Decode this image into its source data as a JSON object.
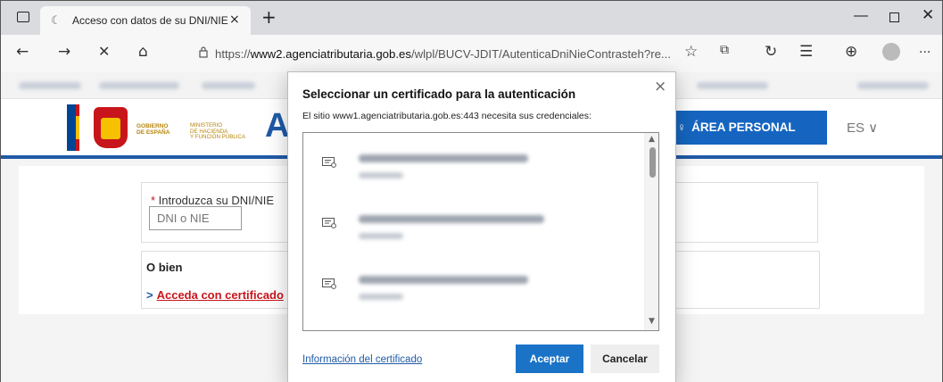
{
  "browser": {
    "tab": {
      "title": "Acceso con datos de su DNI/NIE",
      "close": "×",
      "favicon": "☾"
    },
    "new_tab": "+",
    "window": {
      "minimize": "—",
      "close": "✕"
    },
    "nav": {
      "back": "←",
      "forward": "→",
      "stop": "✕",
      "home": "⌂"
    },
    "address": {
      "url_prefix": "https://",
      "url_host": "www2.agenciatributaria.gob.es",
      "url_path": "/wlpl/BUCV-JDIT/AutenticaDniNieContrasteh?re..."
    },
    "toolbar_icons": {
      "favorite": "☆",
      "extension": "⧉",
      "refresh_ext": "↻",
      "favorites_bar": "☰",
      "collections": "⊕",
      "more": "···"
    }
  },
  "site_header": {
    "gob_text": "GOBIERNO\nDE ESPAÑA",
    "ministry_text": "MINISTERIO\nDE HACIENDA\nY FUNCIÓN PÚBLICA",
    "area_personal": "ÁREA PERSONAL",
    "area_personal_icon": "♀",
    "language": "ES ∨"
  },
  "form": {
    "required_marker": "*",
    "dni_label": " Introduzca su DNI/NIE",
    "dni_placeholder": "DNI o NIE",
    "or_text": "O bien",
    "cert_link_prefix": ">",
    "cert_link": "Acceda con certificado"
  },
  "dialog": {
    "title": "Seleccionar un certificado para la autenticación",
    "subtitle": "El sitio www1.agenciatributaria.gob.es:443 necesita sus credenciales:",
    "close": "×",
    "certificates_count_visible": 3,
    "scroll_up": "▲",
    "scroll_down": "▼",
    "cert_info_link": "Información del certificado",
    "accept_button": "Aceptar",
    "cancel_button": "Cancelar"
  },
  "colors": {
    "accent_blue": "#1a73c7",
    "aeat_blue": "#1f5aa6",
    "spain_red": "#c8151b",
    "spain_yellow": "#f6c200"
  }
}
